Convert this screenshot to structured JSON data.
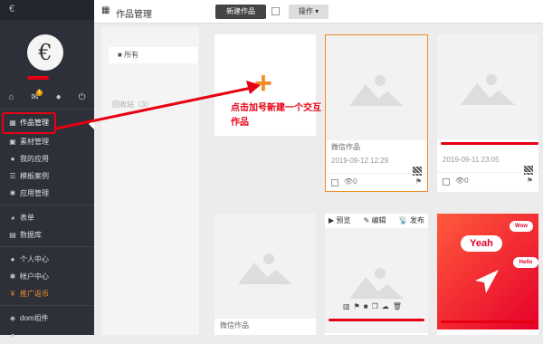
{
  "sidebar": {
    "logo": "€",
    "avatar_glyph": "€",
    "icons": [
      "home-icon",
      "mail-icon",
      "user-icon",
      "power-icon"
    ],
    "badge": "1",
    "items": [
      {
        "label": "作品管理",
        "icon": "grid-icon"
      },
      {
        "label": "素材管理",
        "icon": "image-icon"
      },
      {
        "label": "我的应用",
        "icon": "circle-icon"
      },
      {
        "label": "模板案例",
        "icon": "list-icon"
      },
      {
        "label": "应用管理",
        "icon": "gear-icon"
      },
      {
        "label": "表单",
        "icon": "pie-icon"
      },
      {
        "label": "数据库",
        "icon": "database-icon"
      },
      {
        "label": "个人中心",
        "icon": "user-icon"
      },
      {
        "label": "帐户中心",
        "icon": "gear-icon"
      },
      {
        "label": "推广返币",
        "icon": "yen-icon"
      },
      {
        "label": "dom组件",
        "icon": "layers-icon"
      }
    ]
  },
  "topbar": {
    "title": "作品管理",
    "new_button": "新建作品",
    "ops_button": "操作 ▾"
  },
  "left_panel": {
    "folder_all": "所有",
    "sub_text": "回收站（3）"
  },
  "annotation": "点击加号新建一个交互作品",
  "cards": [
    {
      "title": "微信作品",
      "date": "2019-09-12 12:29",
      "views": "0"
    },
    {
      "title": "",
      "date": "2019-09-11 23:05",
      "views": "0"
    },
    {
      "title": "微信作品"
    }
  ],
  "card_toolbar": {
    "preview": "预览",
    "edit": "编辑",
    "publish": "发布"
  },
  "promo": {
    "yeah": "Yeah",
    "wow": "Wow",
    "hello": "Hello"
  },
  "colors": {
    "accent": "#f28c28",
    "annotation": "#e60012",
    "sidebar": "#2d3038"
  }
}
